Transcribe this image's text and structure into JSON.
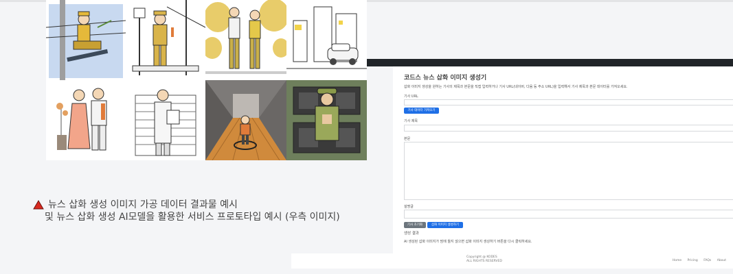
{
  "caption": {
    "line1": "뉴스 삽화 생성 이미지 가공 데이터 결과물 예시",
    "line2": "및 뉴스 삽화 생성 AI모델을 활용한 서비스 프로토타입 예시 (우측 이미지)",
    "marker_color": "#d8291f"
  },
  "images": [
    {
      "icon": "utility-worker-on-pole-image"
    },
    {
      "icon": "worker-at-sign-image"
    },
    {
      "icon": "couple-walking-image"
    },
    {
      "icon": "street-car-image"
    },
    {
      "icon": "wedding-couple-image"
    },
    {
      "icon": "man-reading-document-image"
    },
    {
      "icon": "child-in-hallway-image"
    },
    {
      "icon": "guard-at-console-image"
    }
  ],
  "app": {
    "title": "코드스 뉴스 삽화 이미지 생성기",
    "description": "삽화 이미지 생성을 원하는 기사의 제목과 본문을 직접 입력하거나 기사 URL(네이버, 다음 등 주소 URL)을 입력해서 기사 제목과 본문 데이터를 가져오세요.",
    "url_label": "기사 URL",
    "fetch_button": "기사 데이터 가져오기",
    "headline_label": "기사 제목",
    "body_label": "본문",
    "description_label": "설명글",
    "reset_button": "기사 초기화",
    "generate_button": "삽화 이미지 생성하기",
    "result_label": "생성 결과",
    "result_hint": "AI 생성된 삽화 이미지가 맘에 들지 않으면 삽화 이미지 생성하기 버튼을 다시 클릭하세요.",
    "accent_color": "#1f6fe6"
  },
  "footer": {
    "copyright": "Copyright @ KODES",
    "rights": "ALL RIGHTS RESERVED",
    "links": [
      "Home",
      "Pricing",
      "FAQs",
      "About"
    ]
  }
}
